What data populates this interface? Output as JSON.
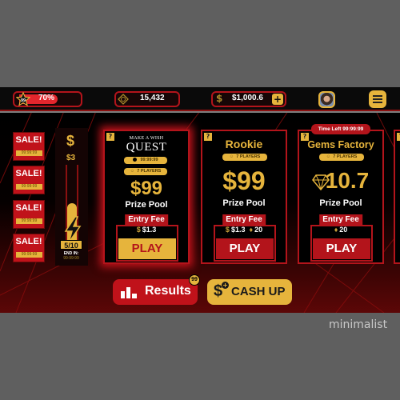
{
  "topbar": {
    "level": "99",
    "xp_percent_label": "70%",
    "xp_progress": 0.7,
    "gems": "15,432",
    "cash": "$1,000.6",
    "add_cash_label": "+"
  },
  "sales": [
    {
      "label": "SALE!",
      "timer": "99:99:99"
    },
    {
      "label": "SALE!",
      "timer": "99:99:99"
    },
    {
      "label": "SALE!",
      "timer": "99:99:99"
    },
    {
      "label": "SALE!",
      "timer": "99:99:99"
    }
  ],
  "meter": {
    "currency_symbol": "$",
    "reward": "$3",
    "progress_fraction": 0.5,
    "count": "5/10",
    "end_label": "END IN:",
    "end_timer": "99:99:99"
  },
  "cards": [
    {
      "help": "?",
      "title_small": "MAKE A WISH",
      "title_big": "QUEST",
      "timer_chip": "99:99:99",
      "players_chip": "7 PLAYERS",
      "prize": "$99",
      "prize_label": "Prize Pool",
      "entry_label": "Entry Fee",
      "fee_cash": "$1.3",
      "play_label": "PLAY"
    },
    {
      "help": "?",
      "title": "Rookie",
      "players_chip": "7 PLAYERS",
      "prize": "$99",
      "prize_label": "Prize Pool",
      "entry_label": "Entry Fee",
      "fee_cash": "$1.3",
      "fee_gems": "20",
      "play_label": "PLAY"
    },
    {
      "help": "?",
      "time_left": "Time Left 99:99:99",
      "title": "Gems Factory",
      "players_chip": "7 PLAYERS",
      "prize": "10.7",
      "prize_label": "Prize Pool",
      "entry_label": "Entry Fee",
      "fee_gems": "20",
      "play_label": "PLAY"
    }
  ],
  "edge_card": {
    "help": "?"
  },
  "bottom": {
    "results_label": "Results",
    "results_badge": "99",
    "cashup_label": "CASH UP",
    "cashup_symbol": "$",
    "cashup_plus": "+"
  },
  "watermark": "minimalist",
  "colors": {
    "accent_gold": "#e6b43c",
    "accent_red": "#b3141b",
    "background": "#000000",
    "frame": "#5f5f5f"
  }
}
